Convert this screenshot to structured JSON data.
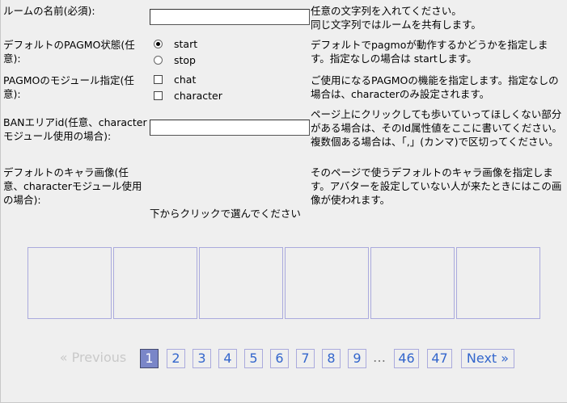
{
  "form": {
    "room_name": {
      "label": "ルームの名前(必須):",
      "value": "",
      "help_line1": "任意の文字列を入れてください。",
      "help_line2": "同じ文字列ではルームを共有します。"
    },
    "default_state": {
      "label": "デフォルトのPAGMO状態(任意):",
      "options": [
        {
          "label": "start",
          "checked": true
        },
        {
          "label": "stop",
          "checked": false
        }
      ],
      "help": "デフォルトでpagmoが動作するかどうかを指定します。指定なしの場合は startします。"
    },
    "modules": {
      "label": "PAGMOのモジュール指定(任意):",
      "options": [
        {
          "label": "chat",
          "checked": false
        },
        {
          "label": "character",
          "checked": false
        }
      ],
      "help": "ご使用になるPAGMOの機能を指定します。指定なしの場合は、characterのみ設定されます。"
    },
    "ban_area": {
      "label": "BANエリアid(任意、characterモジュール使用の場合):",
      "value": "",
      "help": "ページ上にクリックしても歩いていってほしくない部分がある場合は、そのId属性値をここに書いてください。複数個ある場合は、「,」(カンマ)で区切ってください。"
    },
    "default_image": {
      "label": "デフォルトのキャラ画像(任意、characterモジュール使用の場合):",
      "help": "そのページで使うデフォルトのキャラ画像を指定します。アバターを設定していない人が来たときにはこの画像が使われます。",
      "hint": "下からクリックで選んでください"
    }
  },
  "thumbnails_count": 6,
  "pagination": {
    "previous": "« Previous",
    "next": "Next »",
    "pages": [
      "1",
      "2",
      "3",
      "4",
      "5",
      "6",
      "7",
      "8",
      "9"
    ],
    "ellipsis": "…",
    "last_pages": [
      "46",
      "47"
    ],
    "current": "1"
  },
  "colors": {
    "accent": "#7a86c8",
    "link": "#3366cc",
    "border": "#aaaadd",
    "background": "#efefef"
  }
}
